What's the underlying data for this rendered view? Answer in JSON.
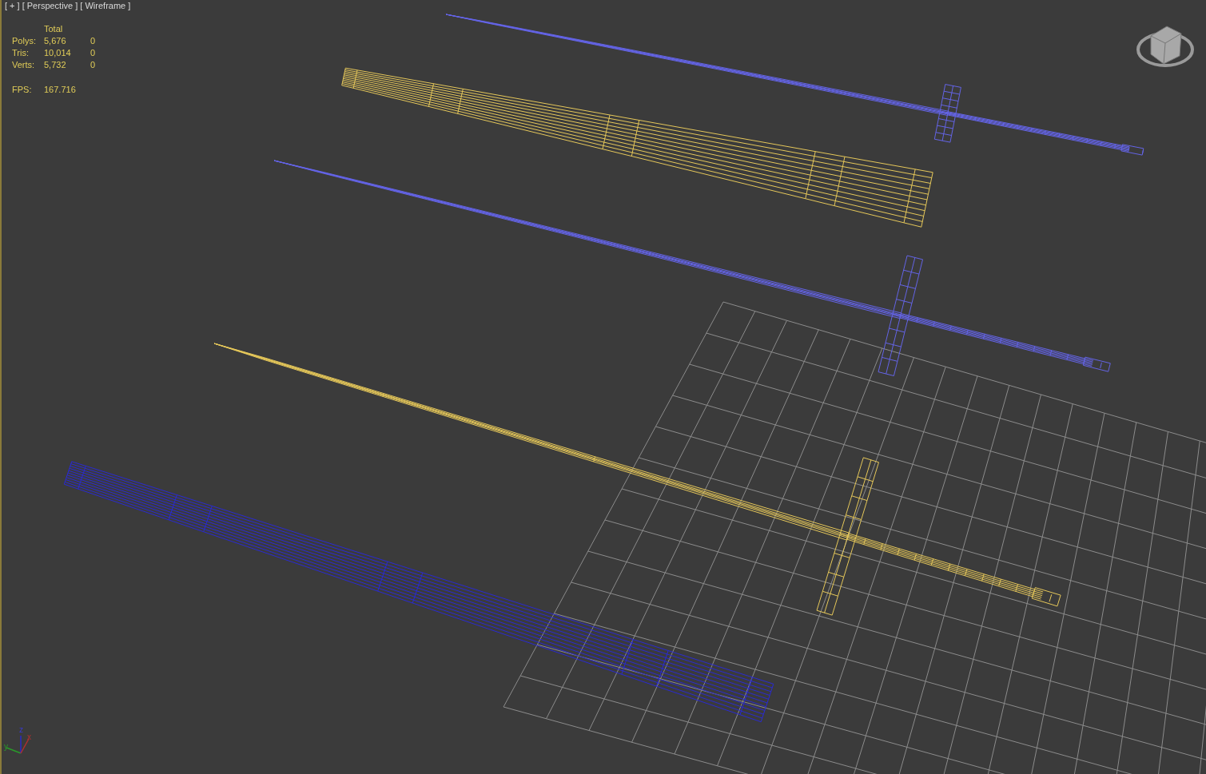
{
  "viewport": {
    "labels": [
      "[ + ]",
      "[ Perspective ]",
      "[ Wireframe ]"
    ]
  },
  "stats": {
    "header": "Total",
    "rows": [
      {
        "label": "Polys:",
        "total": "5,676",
        "selected": "0"
      },
      {
        "label": "Tris:",
        "total": "10,014",
        "selected": "0"
      },
      {
        "label": "Verts:",
        "total": "5,732",
        "selected": "0"
      }
    ],
    "fps_label": "FPS:",
    "fps": "167.716"
  },
  "models": [
    {
      "kind": "sword",
      "color": "#6464e6"
    },
    {
      "kind": "scabbard",
      "color": "#e6c85a"
    },
    {
      "kind": "sword",
      "color": "#6464e6"
    },
    {
      "kind": "sword",
      "color": "#e6c85a"
    },
    {
      "kind": "scabbard",
      "color": "#2a2ad2"
    }
  ],
  "axes": [
    "x",
    "y",
    "z"
  ]
}
